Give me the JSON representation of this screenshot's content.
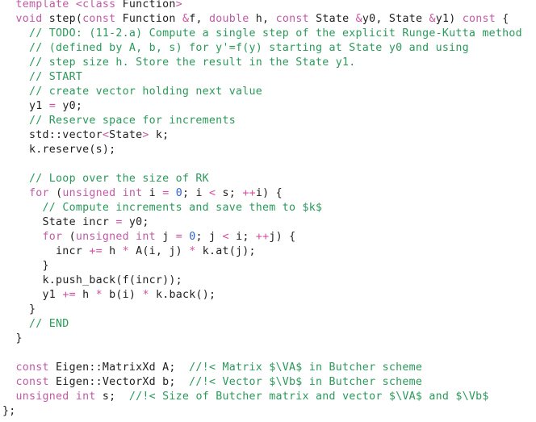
{
  "editor": {
    "colors": {
      "background": "#ffffff",
      "keyword": "#c25aa6",
      "comment": "#2a9a5a",
      "operator": "#d24fa0",
      "number": "#2b5fd9",
      "text": "#1f1f1f"
    },
    "lines": [
      [
        [
          "  ",
          "tx"
        ],
        [
          "template",
          "kw"
        ],
        [
          " ",
          "tx"
        ],
        [
          "<",
          "ang"
        ],
        [
          "class",
          "kw"
        ],
        [
          " Function",
          "tx"
        ],
        [
          ">",
          "ang"
        ]
      ],
      [
        [
          "  ",
          "tx"
        ],
        [
          "void",
          "kw"
        ],
        [
          " step(",
          "tx"
        ],
        [
          "const",
          "kw"
        ],
        [
          " Function ",
          "tx"
        ],
        [
          "&",
          "op"
        ],
        [
          "f, ",
          "tx"
        ],
        [
          "double",
          "kw"
        ],
        [
          " h, ",
          "tx"
        ],
        [
          "const",
          "kw"
        ],
        [
          " State ",
          "tx"
        ],
        [
          "&",
          "op"
        ],
        [
          "y0, State ",
          "tx"
        ],
        [
          "&",
          "op"
        ],
        [
          "y1) ",
          "tx"
        ],
        [
          "const",
          "kw"
        ],
        [
          " {",
          "tx"
        ]
      ],
      [
        [
          "    ",
          "tx"
        ],
        [
          "// TODO: (11-2.a) Compute a single step of the explicit Runge-Kutta method",
          "cm"
        ]
      ],
      [
        [
          "    ",
          "tx"
        ],
        [
          "// (defined by A, b, s) for y'=f(y) starting at State y0 and using",
          "cm"
        ]
      ],
      [
        [
          "    ",
          "tx"
        ],
        [
          "// step size h. Store the result in the State y1.",
          "cm"
        ]
      ],
      [
        [
          "    ",
          "tx"
        ],
        [
          "// START",
          "cm"
        ]
      ],
      [
        [
          "    ",
          "tx"
        ],
        [
          "// create vector holding next value",
          "cm"
        ]
      ],
      [
        [
          "    ",
          "tx"
        ],
        [
          "y1 ",
          "tx"
        ],
        [
          "=",
          "op"
        ],
        [
          " y0;",
          "tx"
        ]
      ],
      [
        [
          "    ",
          "tx"
        ],
        [
          "// Reserve space for increments",
          "cm"
        ]
      ],
      [
        [
          "    ",
          "tx"
        ],
        [
          "std::vector",
          "tx"
        ],
        [
          "<",
          "ang"
        ],
        [
          "State",
          "tx"
        ],
        [
          ">",
          "ang"
        ],
        [
          " k;",
          "tx"
        ]
      ],
      [
        [
          "    ",
          "tx"
        ],
        [
          "k.reserve(s);",
          "tx"
        ]
      ],
      [
        [
          "",
          "tx"
        ]
      ],
      [
        [
          "    ",
          "tx"
        ],
        [
          "// Loop over the size of RK",
          "cm"
        ]
      ],
      [
        [
          "    ",
          "tx"
        ],
        [
          "for",
          "kw"
        ],
        [
          " (",
          "tx"
        ],
        [
          "unsigned",
          "kw"
        ],
        [
          " ",
          "tx"
        ],
        [
          "int",
          "kw"
        ],
        [
          " i ",
          "tx"
        ],
        [
          "=",
          "op"
        ],
        [
          " ",
          "tx"
        ],
        [
          "0",
          "num"
        ],
        [
          "; i ",
          "tx"
        ],
        [
          "<",
          "op"
        ],
        [
          " s; ",
          "tx"
        ],
        [
          "++",
          "op"
        ],
        [
          "i) {",
          "tx"
        ]
      ],
      [
        [
          "      ",
          "tx"
        ],
        [
          "// Compute increments and save them to $k$",
          "cm"
        ]
      ],
      [
        [
          "      ",
          "tx"
        ],
        [
          "State incr ",
          "tx"
        ],
        [
          "=",
          "op"
        ],
        [
          " y0;",
          "tx"
        ]
      ],
      [
        [
          "      ",
          "tx"
        ],
        [
          "for",
          "kw"
        ],
        [
          " (",
          "tx"
        ],
        [
          "unsigned",
          "kw"
        ],
        [
          " ",
          "tx"
        ],
        [
          "int",
          "kw"
        ],
        [
          " j ",
          "tx"
        ],
        [
          "=",
          "op"
        ],
        [
          " ",
          "tx"
        ],
        [
          "0",
          "num"
        ],
        [
          "; j ",
          "tx"
        ],
        [
          "<",
          "op"
        ],
        [
          " i; ",
          "tx"
        ],
        [
          "++",
          "op"
        ],
        [
          "j) {",
          "tx"
        ]
      ],
      [
        [
          "        ",
          "tx"
        ],
        [
          "incr ",
          "tx"
        ],
        [
          "+=",
          "op"
        ],
        [
          " h ",
          "tx"
        ],
        [
          "*",
          "op"
        ],
        [
          " A(i, j) ",
          "tx"
        ],
        [
          "*",
          "op"
        ],
        [
          " k.at(j);",
          "tx"
        ]
      ],
      [
        [
          "      ",
          "tx"
        ],
        [
          "}",
          "tx"
        ]
      ],
      [
        [
          "      ",
          "tx"
        ],
        [
          "k.push_back(f(incr));",
          "tx"
        ]
      ],
      [
        [
          "      ",
          "tx"
        ],
        [
          "y1 ",
          "tx"
        ],
        [
          "+=",
          "op"
        ],
        [
          " h ",
          "tx"
        ],
        [
          "*",
          "op"
        ],
        [
          " b(i) ",
          "tx"
        ],
        [
          "*",
          "op"
        ],
        [
          " k.back();",
          "tx"
        ]
      ],
      [
        [
          "    ",
          "tx"
        ],
        [
          "}",
          "tx"
        ]
      ],
      [
        [
          "    ",
          "tx"
        ],
        [
          "// END",
          "cm"
        ]
      ],
      [
        [
          "  ",
          "tx"
        ],
        [
          "}",
          "tx"
        ]
      ],
      [
        [
          "",
          "tx"
        ]
      ],
      [
        [
          "  ",
          "tx"
        ],
        [
          "const",
          "kw"
        ],
        [
          " Eigen::MatrixXd A;  ",
          "tx"
        ],
        [
          "//!< Matrix $\\VA$ in Butcher scheme",
          "cm"
        ]
      ],
      [
        [
          "  ",
          "tx"
        ],
        [
          "const",
          "kw"
        ],
        [
          " Eigen::VectorXd b;  ",
          "tx"
        ],
        [
          "//!< Vector $\\Vb$ in Butcher scheme",
          "cm"
        ]
      ],
      [
        [
          "  ",
          "tx"
        ],
        [
          "unsigned",
          "kw"
        ],
        [
          " ",
          "tx"
        ],
        [
          "int",
          "kw"
        ],
        [
          " s;  ",
          "tx"
        ],
        [
          "//!< Size of Butcher matrix and vector $\\VA$ and $\\Vb$",
          "cm"
        ]
      ],
      [
        [
          "};",
          "tx"
        ]
      ]
    ]
  }
}
